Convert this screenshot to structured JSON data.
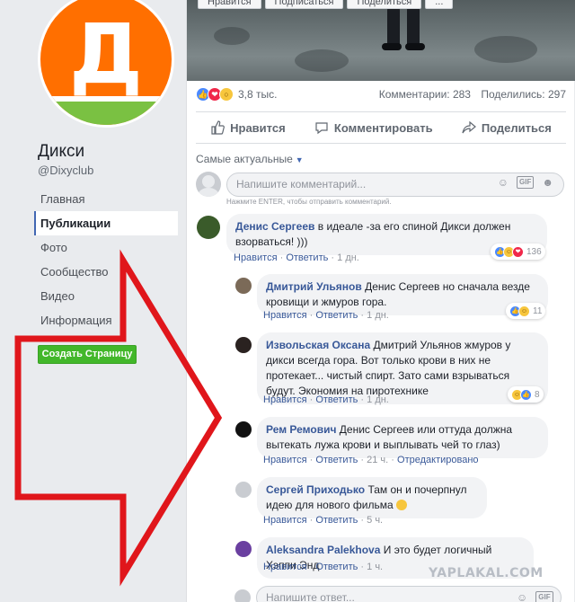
{
  "page": {
    "name": "Дикси",
    "handle": "@Dixyclub",
    "logo_letter": "Д",
    "create_page_label": "Создать Страницу",
    "nav": [
      {
        "label": "Главная",
        "active": false
      },
      {
        "label": "Публикации",
        "active": true
      },
      {
        "label": "Фото",
        "active": false
      },
      {
        "label": "Сообщество",
        "active": false
      },
      {
        "label": "Видео",
        "active": false
      },
      {
        "label": "Информация",
        "active": false
      }
    ]
  },
  "top_actions": [
    "Нравится",
    "Подписаться",
    "Поделиться",
    "..."
  ],
  "post": {
    "reaction_count": "3,8 тыс.",
    "comments_label": "Комментарии: 283",
    "shares_label": "Поделились: 297",
    "like_label": "Нравится",
    "comment_label": "Комментировать",
    "share_label": "Поделиться"
  },
  "comments_section": {
    "sort_label": "Самые актуальные",
    "input_placeholder": "Напишите комментарий...",
    "hint": "Нажмите ENTER, чтобы отправить комментарий.",
    "reply_placeholder": "Напишите ответ...",
    "gif_label": "GIF"
  },
  "comments": [
    {
      "author": "Денис Сергеев",
      "text": "в идеале -за его спиной Дикси должен взорваться! )))",
      "like": "Нравится",
      "reply": "Ответить",
      "time": "1 дн.",
      "reactions": "136"
    },
    {
      "author": "Дмитрий Ульянов",
      "text": "Денис Сергеев но сначала везде кровищи и жмуров гора.",
      "like": "Нравится",
      "reply": "Ответить",
      "time": "1 дн.",
      "reactions": "11"
    },
    {
      "author": "Извольская Оксана",
      "text": "Дмитрий Ульянов жмуров у дикси всегда гора. Вот только крови в них не протекает... чистый спирт. Зато сами взрываться будут. Экономия на пиротехнике",
      "like": "Нравится",
      "reply": "Ответить",
      "time": "1 дн.",
      "reactions": "8"
    },
    {
      "author": "Рем Ремович",
      "text": "Денис Сергеев или оттуда должна вытекать лужа крови и выплывать чей то глаз)",
      "like": "Нравится",
      "reply": "Ответить",
      "time": "21 ч.",
      "edited": "Отредактировано"
    },
    {
      "author": "Сергей Приходько",
      "text": "Там он и почерпнул идею для нового фильма",
      "like": "Нравится",
      "reply": "Ответить",
      "time": "5 ч."
    },
    {
      "author": "Aleksandra Palekhova",
      "text": "И это будет логичный Хэппи Энд",
      "like": "Нравится",
      "reply": "Ответить",
      "time": "1 ч."
    }
  ],
  "watermark": "YAPLAKAL.COM",
  "colors": {
    "facebook_blue": "#4267b2",
    "link": "#385898",
    "dixy_orange": "#ff6f00",
    "dixy_green": "#7ac142",
    "arrow_red": "#e0161b",
    "create_green": "#42b72a"
  }
}
